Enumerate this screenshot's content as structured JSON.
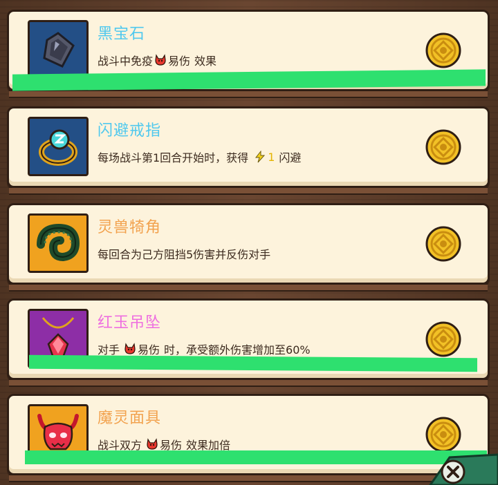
{
  "items": [
    {
      "title": "黑宝石",
      "title_color": "#4fc8ee",
      "icon": "black-gem-icon",
      "icon_bg": "#234f86",
      "desc_pre": "战斗中免疫",
      "desc_badge": "易伤",
      "desc_post": "效果"
    },
    {
      "title": "闪避戒指",
      "title_color": "#4fc8ee",
      "icon": "dodge-ring-icon",
      "icon_bg": "#234f86",
      "desc_pre": "每场战斗第1回合开始时，获得",
      "desc_num": "1",
      "desc_post": "闪避"
    },
    {
      "title": "灵兽犄角",
      "title_color": "#f2a24e",
      "icon": "spirit-horn-icon",
      "icon_bg": "#f0a21f",
      "desc_full": "每回合为己方阻挡5伤害并反伤对手"
    },
    {
      "title": "红玉吊坠",
      "title_color": "#ee6ee0",
      "icon": "ruby-pendant-icon",
      "icon_bg": "#8d2ea6",
      "desc_pre": "对手",
      "desc_badge": "易伤",
      "desc_post": "时，承受额外伤害增加至60%"
    },
    {
      "title": "魔灵面具",
      "title_color": "#f2a24e",
      "icon": "demon-mask-icon",
      "icon_bg": "#f0a21f",
      "desc_pre": "战斗双方",
      "desc_badge": "易伤",
      "desc_post": "效果加倍"
    }
  ],
  "coin_icon": "gold-coin-icon",
  "close_icon": "close-icon",
  "accent_green": "#2ee06f"
}
